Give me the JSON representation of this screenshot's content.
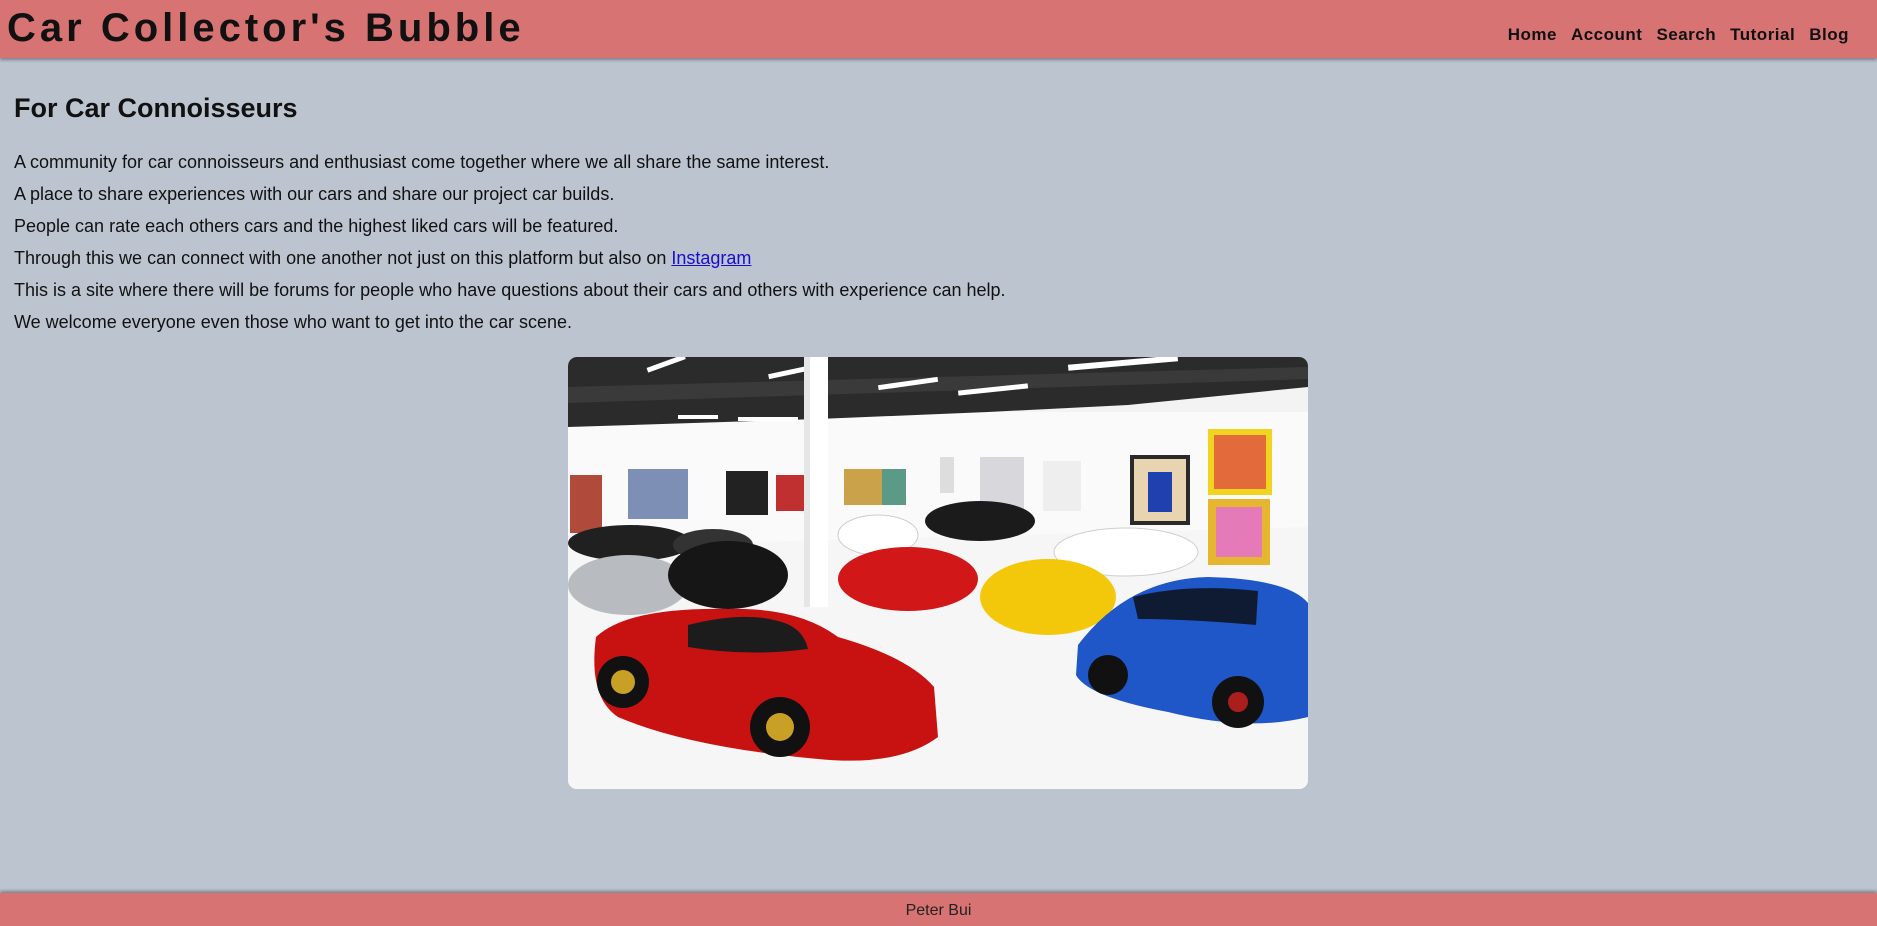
{
  "header": {
    "title": "Car Collector's Bubble",
    "nav": [
      "Home",
      "Account",
      "Search",
      "Tutorial",
      "Blog"
    ]
  },
  "main": {
    "heading": "For Car Connoisseurs",
    "paragraphs": [
      "A community for car connoisseurs and enthusiast come together where we all share the same interest.",
      "A place to share experiences with our cars and share our project car builds.",
      "People can rate each others cars and the highest liked cars will be featured.",
      "Through this we can connect with one another not just on this platform but also on ",
      "This is a site where there will be forums for people who have questions about their cars and others with experience can help.",
      "We welcome everyone even those who want to get into the car scene."
    ],
    "instagram_link": "Instagram",
    "image_icon": "car-showroom-photo"
  },
  "footer": {
    "author": "Peter Bui"
  },
  "colors": {
    "header_bg": "#d87373",
    "page_bg": "#bcc4d0",
    "link": "#1a0dcc"
  }
}
